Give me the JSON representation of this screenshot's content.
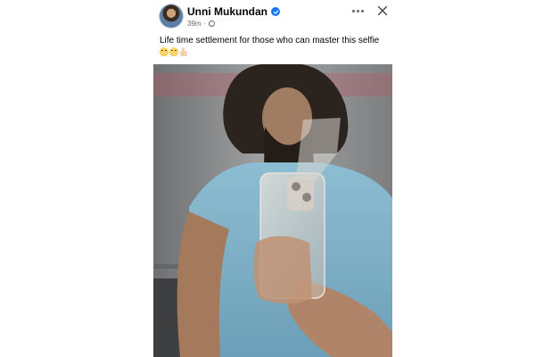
{
  "post": {
    "author_name": "Unni Mukundan",
    "timestamp": "39m",
    "meta_separator": "·",
    "caption": "Life time settlement for those who can master this selfie",
    "caption_emojis": [
      "relieved-face",
      "smirking-face",
      "thumbs-up-light-skin"
    ],
    "photo_icon": "mirror-selfie-photo",
    "colors": {
      "verified_badge": "#1877f2",
      "text_primary": "#050505",
      "text_secondary": "#65676b",
      "shirt": "#7fb0c8"
    }
  }
}
